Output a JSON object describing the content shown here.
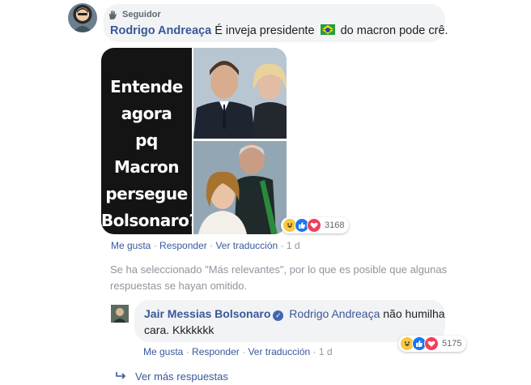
{
  "comment": {
    "badge": "Seguidor",
    "author": "Rodrigo Andreaça",
    "text_before_flag": "É inveja presidente",
    "text_after_flag": "do macron pode crê.",
    "image_text": [
      "Entende",
      "agora",
      "pq Macron",
      "persegue",
      "Bolsonaro?"
    ],
    "reaction_count": "3168",
    "actions": {
      "like": "Me gusta",
      "reply": "Responder",
      "translate": "Ver traducción",
      "time": "1 d"
    }
  },
  "notice": {
    "text": "Se ha seleccionado \"Más relevantes\", por lo que es posible que algunas respuestas se hayan omitido."
  },
  "reply": {
    "author": "Jair Messias Bolsonaro",
    "mention": "Rodrigo Andreaça",
    "text_line1_rest": "não humilha",
    "text_line2": "cara. Kkkkkkk",
    "reaction_count": "5175",
    "actions": {
      "like": "Me gusta",
      "reply": "Responder",
      "translate": "Ver traducción",
      "time": "1 d"
    }
  },
  "more_replies": {
    "label": "Ver más respuestas"
  },
  "icons": {
    "badge": "wave-hand-icon",
    "reply_arrow": "reply-arrow-icon",
    "verified": "verified-check-icon",
    "flag": "brazil-flag-icon"
  },
  "colors": {
    "link": "#385898",
    "bubble": "#f2f3f5",
    "muted": "#90949c",
    "like": "#1877f2",
    "love": "#f33e58",
    "haha": "#f7c843"
  }
}
